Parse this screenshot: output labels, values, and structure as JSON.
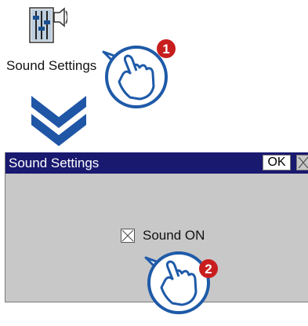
{
  "desktop": {
    "icon_label": "Sound Settings"
  },
  "dialog": {
    "title": "Sound Settings",
    "ok_label": "OK",
    "checkbox_label": "Sound ON",
    "checkbox_checked": true
  },
  "callouts": [
    {
      "number": "1"
    },
    {
      "number": "2"
    }
  ],
  "colors": {
    "titlebar": "#191970",
    "dialog_bg": "#c8c8c8",
    "arrow": "#1f56a6",
    "callout_badge": "#c81e1e",
    "hand_stroke": "#1e5aa8"
  }
}
